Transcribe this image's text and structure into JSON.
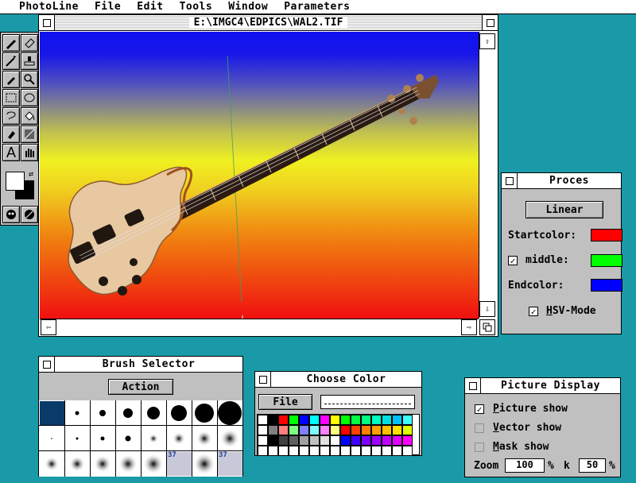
{
  "menubar": {
    "items": [
      "PhotoLine",
      "File",
      "Edit",
      "Tools",
      "Window",
      "Parameters"
    ]
  },
  "image_window": {
    "title": "E:\\IMGC4\\EDPICS\\WAL2.TIF",
    "gradient_colors": [
      "#1010f0",
      "#f0f020",
      "#f01010"
    ]
  },
  "toolbox": {
    "tools": [
      "brush-icon",
      "eraser-icon",
      "magic-wand-icon",
      "stamp-icon",
      "eyedropper-icon",
      "zoom-icon",
      "rect-select-icon",
      "ellipse-select-icon",
      "lasso-icon",
      "fill-bucket-icon",
      "airbrush-icon",
      "gradient-icon",
      "text-icon",
      "hand-icon",
      "mask-a-icon",
      "mask-b-icon"
    ],
    "text_tool_label": "A"
  },
  "proces": {
    "title": "Proces",
    "mode_button": "Linear",
    "startcolor_label": "Startcolor:",
    "middle_label": "middle:",
    "endcolor_label": "Endcolor:",
    "hsv_label": "HSV-Mode",
    "middle_checked": "✓",
    "hsv_checked": "✓",
    "colors": {
      "start": "#ff0000",
      "middle": "#00ff00",
      "end": "#0000ff"
    }
  },
  "brush_selector": {
    "title": "Brush Selector",
    "action_button": "Action",
    "badge_1": "37",
    "badge_2": "37"
  },
  "choose_color": {
    "title": "Choose Color",
    "file_button": "File",
    "palette_rows": [
      [
        "#ffffff",
        "#000000",
        "#ff0000",
        "#00ff00",
        "#0000ff",
        "#00ffff",
        "#ff00ff",
        "#ffff00",
        "#00ff00",
        "#00ff40",
        "#00ff80",
        "#00ffc0",
        "#00e0e0",
        "#00c0ff",
        "#40ffff"
      ],
      [
        "#ffffff",
        "#808080",
        "#ff8080",
        "#80ff80",
        "#8080ff",
        "#80ffff",
        "#ff80ff",
        "#ffff80",
        "#ff0000",
        "#ff4000",
        "#ff8000",
        "#ffa000",
        "#ffc000",
        "#ffe000",
        "#e0ff00"
      ],
      [
        "#ffffff",
        "#000000",
        "#404040",
        "#606060",
        "#a0a0a0",
        "#c0c0c0",
        "#e0e0e0",
        "#ffffff",
        "#0000ff",
        "#4000ff",
        "#8000ff",
        "#a000ff",
        "#c000ff",
        "#e000ff",
        "#ff00ff"
      ],
      [
        "#ffffff",
        "#ffffff",
        "#ffffff",
        "#ffffff",
        "#ffffff",
        "#ffffff",
        "#ffffff",
        "#ffffff",
        "#ffffff",
        "#ffffff",
        "#ffffff",
        "#ffffff",
        "#ffffff",
        "#ffffff",
        "#ffffff"
      ]
    ]
  },
  "picture_display": {
    "title": "Picture Display",
    "picture_show": "Picture show",
    "vector_show": "Vector show",
    "mask_show": "Mask show",
    "picture_checked": "✓",
    "zoom_label": "Zoom",
    "zoom_value": "100",
    "percent": "%",
    "k_label": "k",
    "k_value": "50"
  }
}
